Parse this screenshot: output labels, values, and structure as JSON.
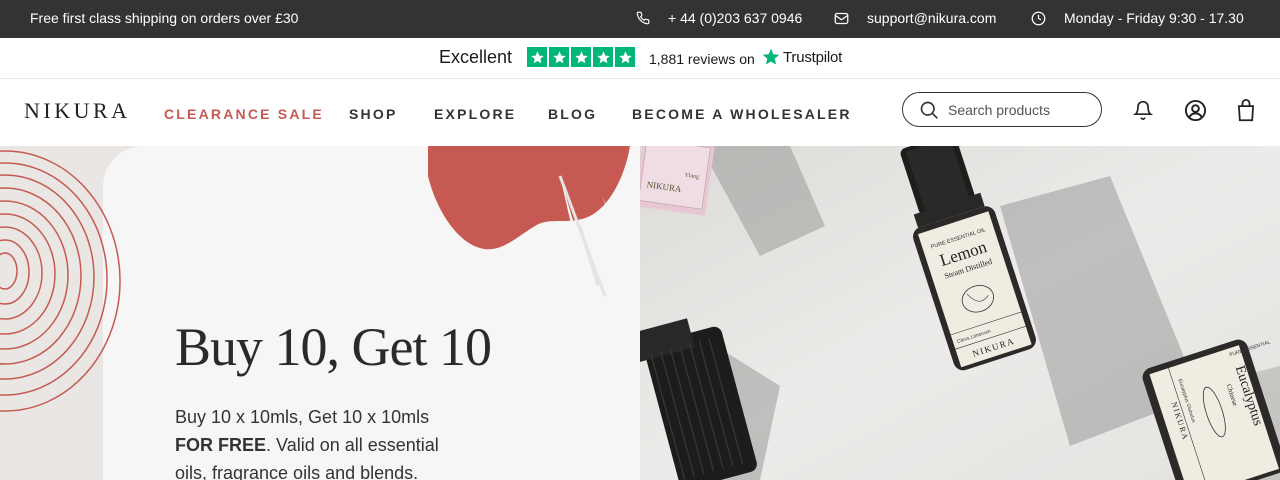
{
  "topbar": {
    "promo": "Free first class shipping on orders over £30",
    "phone": "+ 44 (0)203 637 0946",
    "email": "support@nikura.com",
    "hours": "Monday - Friday 9:30 - 17.30"
  },
  "trustpilot": {
    "rating_word": "Excellent",
    "stars": 5,
    "reviews": "1,881 reviews on",
    "brand": "Trustpilot",
    "star_color": "#00b67a"
  },
  "nav": {
    "logo": "NIKURA",
    "items": [
      {
        "label": "CLEARANCE SALE",
        "highlight": true
      },
      {
        "label": "SHOP"
      },
      {
        "label": "EXPLORE"
      },
      {
        "label": "BLOG"
      },
      {
        "label": "BECOME A WHOLESALER"
      }
    ],
    "search_placeholder": "Search products",
    "accent_color": "#c65a52"
  },
  "hero": {
    "title": "Buy 10, Get 10",
    "text_part1": "Buy 10 x 10mls, Get 10 x 10mls",
    "text_bold": "FOR FREE",
    "text_part2": ". Valid on all essential oils, fragrance oils and blends."
  },
  "products": {
    "lemon_top": "PURE ESSENTIAL OIL",
    "lemon_name": "Lemon",
    "lemon_sub": "Steam Distilled",
    "lemon_latin": "Citrus Limonum",
    "lemon_brand": "NIKURA",
    "euc_top": "PURE ESSENTIAL",
    "euc_name": "Eucalyptus",
    "euc_sub": "Chinese",
    "euc_latin": "Eucalyptus Globulus",
    "euc_brand": "NIKURA",
    "pink_brand": "NIKURA",
    "pink_text": "Ylang"
  }
}
